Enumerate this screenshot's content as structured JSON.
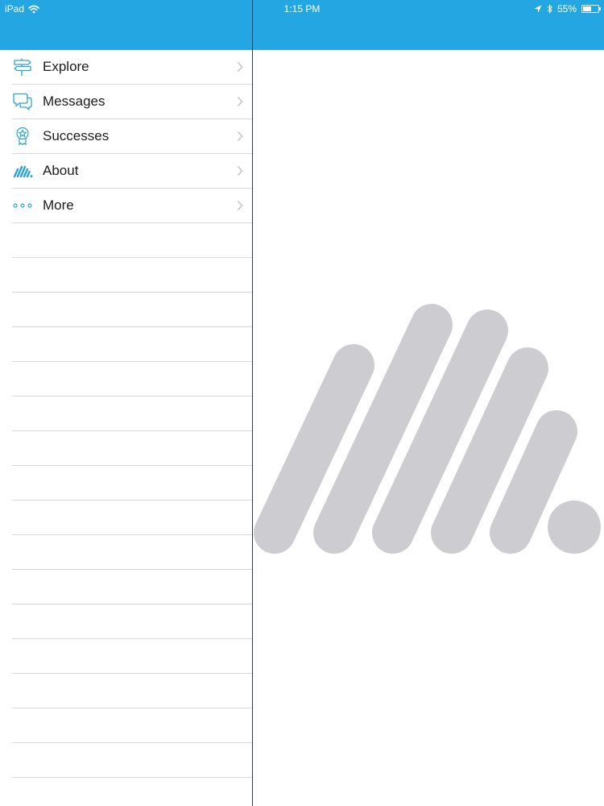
{
  "status_bar": {
    "device": "iPad",
    "time": "1:15 PM",
    "battery_percent": "55%",
    "battery_level": 0.55,
    "icons": [
      "wifi-icon",
      "location-icon",
      "bluetooth-icon",
      "battery-icon"
    ]
  },
  "menu": {
    "items": [
      {
        "label": "Explore",
        "icon": "signpost-icon"
      },
      {
        "label": "Messages",
        "icon": "chat-bubbles-icon"
      },
      {
        "label": "Successes",
        "icon": "award-ribbon-icon"
      },
      {
        "label": "About",
        "icon": "brand-logo-icon"
      },
      {
        "label": "More",
        "icon": "ellipsis-icon"
      }
    ],
    "empty_rows": 17
  },
  "detail": {
    "logo": "brand-logo-watermark"
  },
  "colors": {
    "nav_bar": "#23a6e2",
    "icon_accent": "#2aa3d8",
    "logo_gray": "#cdccd0",
    "separator": "#d8d8dc",
    "divider": "#2b3a44",
    "chevron": "#c4c4c8"
  }
}
